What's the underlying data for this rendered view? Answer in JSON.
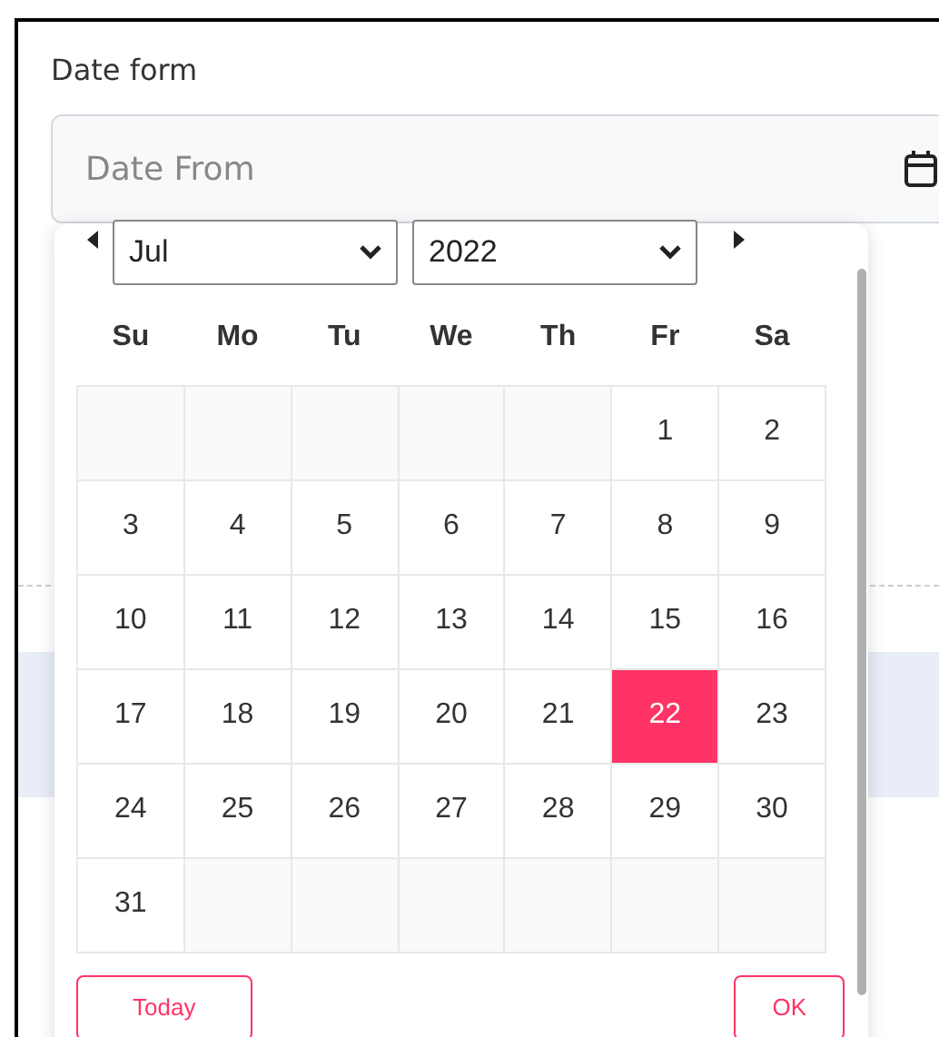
{
  "form_label": "Date form",
  "date_field": {
    "placeholder": "Date From"
  },
  "calendar": {
    "month": "Jul",
    "year": "2022",
    "weekdays": [
      "Su",
      "Mo",
      "Tu",
      "We",
      "Th",
      "Fr",
      "Sa"
    ],
    "weeks": [
      [
        {
          "kind": "blank"
        },
        {
          "kind": "blank"
        },
        {
          "kind": "blank"
        },
        {
          "kind": "blank"
        },
        {
          "kind": "blank"
        },
        {
          "kind": "day",
          "day": "1",
          "selected": false
        },
        {
          "kind": "day",
          "day": "2",
          "selected": false
        }
      ],
      [
        {
          "kind": "day",
          "day": "3",
          "selected": false
        },
        {
          "kind": "day",
          "day": "4",
          "selected": false
        },
        {
          "kind": "day",
          "day": "5",
          "selected": false
        },
        {
          "kind": "day",
          "day": "6",
          "selected": false
        },
        {
          "kind": "day",
          "day": "7",
          "selected": false
        },
        {
          "kind": "day",
          "day": "8",
          "selected": false
        },
        {
          "kind": "day",
          "day": "9",
          "selected": false
        }
      ],
      [
        {
          "kind": "day",
          "day": "10",
          "selected": false
        },
        {
          "kind": "day",
          "day": "11",
          "selected": false
        },
        {
          "kind": "day",
          "day": "12",
          "selected": false
        },
        {
          "kind": "day",
          "day": "13",
          "selected": false
        },
        {
          "kind": "day",
          "day": "14",
          "selected": false
        },
        {
          "kind": "day",
          "day": "15",
          "selected": false
        },
        {
          "kind": "day",
          "day": "16",
          "selected": false
        }
      ],
      [
        {
          "kind": "day",
          "day": "17",
          "selected": false
        },
        {
          "kind": "day",
          "day": "18",
          "selected": false
        },
        {
          "kind": "day",
          "day": "19",
          "selected": false
        },
        {
          "kind": "day",
          "day": "20",
          "selected": false
        },
        {
          "kind": "day",
          "day": "21",
          "selected": false
        },
        {
          "kind": "day",
          "day": "22",
          "selected": true
        },
        {
          "kind": "day",
          "day": "23",
          "selected": false
        }
      ],
      [
        {
          "kind": "day",
          "day": "24",
          "selected": false
        },
        {
          "kind": "day",
          "day": "25",
          "selected": false
        },
        {
          "kind": "day",
          "day": "26",
          "selected": false
        },
        {
          "kind": "day",
          "day": "27",
          "selected": false
        },
        {
          "kind": "day",
          "day": "28",
          "selected": false
        },
        {
          "kind": "day",
          "day": "29",
          "selected": false
        },
        {
          "kind": "day",
          "day": "30",
          "selected": false
        }
      ],
      [
        {
          "kind": "day",
          "day": "31",
          "selected": false
        },
        {
          "kind": "blank"
        },
        {
          "kind": "blank"
        },
        {
          "kind": "blank"
        },
        {
          "kind": "blank"
        },
        {
          "kind": "blank"
        },
        {
          "kind": "blank"
        }
      ]
    ],
    "buttons": [
      "Today",
      "OK"
    ]
  }
}
